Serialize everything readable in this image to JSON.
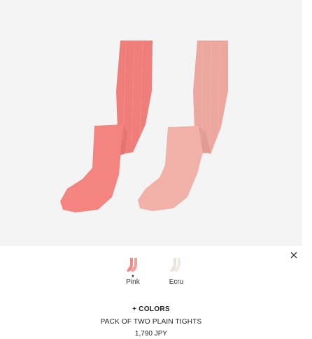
{
  "product": {
    "colors_label": "+ COLORS",
    "name": "PACK OF TWO PLAIN TIGHTS",
    "price": "1,790 JPY"
  },
  "close_icon": "close-icon",
  "swatches": [
    {
      "label": "Pink",
      "color": "#f28b86",
      "selected": true
    },
    {
      "label": "Ecru",
      "color": "#ece7dd",
      "selected": false
    }
  ],
  "image": {
    "background": "#f4f4f4",
    "tights": [
      {
        "name": "coral-tights",
        "color": "#f2807c"
      },
      {
        "name": "pale-pink-tights",
        "color": "#f0aaa2"
      }
    ]
  }
}
